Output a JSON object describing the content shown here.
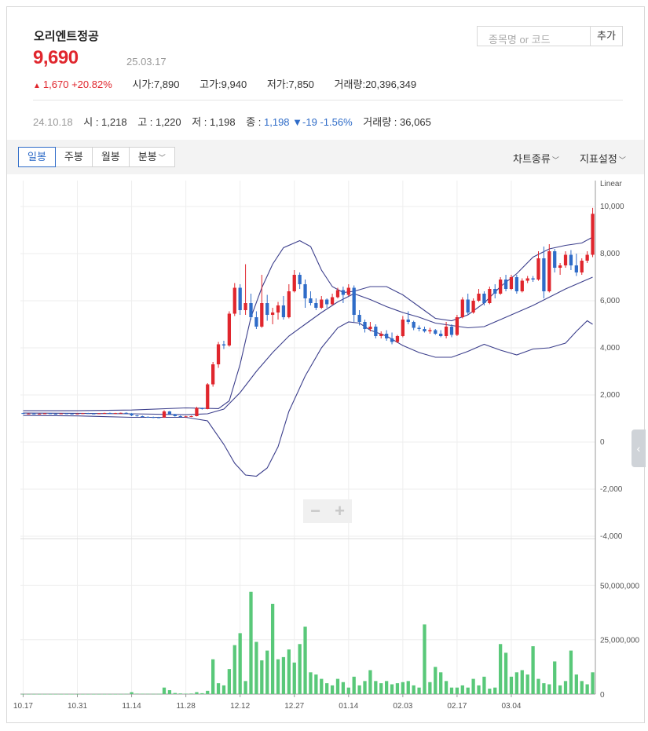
{
  "header": {
    "name": "오리엔트정공",
    "price": "9,690",
    "date": "25.03.17",
    "change_arrow": "▲",
    "change": "1,670",
    "change_pct": "+20.82%",
    "open_label": "시가",
    "open": "7,890",
    "high_label": "고가",
    "high": "9,940",
    "low_label": "저가",
    "low": "7,850",
    "volume_label": "거래량",
    "volume": "20,396,349"
  },
  "search": {
    "placeholder": "종목명 or 코드",
    "add_label": "추가"
  },
  "prev": {
    "date": "24.10.18",
    "open_label": "시",
    "open": "1,218",
    "high_label": "고",
    "high": "1,220",
    "low_label": "저",
    "low": "1,198",
    "close_label": "종",
    "close": "1,198",
    "change_arrow": "▼",
    "change": "-19",
    "change_pct": "-1.56%",
    "volume_label": "거래량",
    "volume": "36,065"
  },
  "toolbar": {
    "tabs": [
      "일봉",
      "주봉",
      "월봉",
      "분봉"
    ],
    "active_tab": 0,
    "chart_type_label": "차트종류",
    "indicator_label": "지표설정"
  },
  "zoom": {
    "minus": "−",
    "plus": "+"
  },
  "colors": {
    "up": "#e0262d",
    "down": "#2f6cc8",
    "bollinger": "#3c3f8c",
    "volume": "#59c879",
    "accent": "#2f6cc8"
  },
  "chart_data": [
    {
      "type": "candlestick",
      "scale_label": "Linear",
      "ylim": [
        -4000,
        11000
      ],
      "y_ticks": [
        10000,
        8000,
        6000,
        4000,
        2000,
        0,
        -2000,
        -4000
      ],
      "y_tick_labels": [
        "10,000",
        "8,000",
        "6,000",
        "4,000",
        "2,000",
        "0",
        "-2,000",
        "-4,000"
      ],
      "x_tick_labels": [
        "10.17",
        "10.31",
        "11.14",
        "11.28",
        "12.12",
        "12.27",
        "01.14",
        "02.03",
        "02.17",
        "03.04"
      ],
      "x_tick_index": [
        0,
        10,
        20,
        30,
        40,
        50,
        60,
        70,
        80,
        90
      ],
      "indicators": [
        "Bollinger Bands"
      ],
      "candles": [
        [
          1230,
          1240,
          1190,
          1200
        ],
        [
          1200,
          1220,
          1180,
          1210
        ],
        [
          1210,
          1230,
          1190,
          1195
        ],
        [
          1195,
          1215,
          1175,
          1205
        ],
        [
          1205,
          1230,
          1190,
          1220
        ],
        [
          1220,
          1235,
          1195,
          1200
        ],
        [
          1200,
          1215,
          1180,
          1190
        ],
        [
          1190,
          1225,
          1185,
          1215
        ],
        [
          1215,
          1230,
          1195,
          1205
        ],
        [
          1205,
          1215,
          1180,
          1195
        ],
        [
          1195,
          1220,
          1185,
          1210
        ],
        [
          1210,
          1235,
          1195,
          1225
        ],
        [
          1225,
          1240,
          1200,
          1210
        ],
        [
          1210,
          1225,
          1190,
          1200
        ],
        [
          1200,
          1230,
          1195,
          1220
        ],
        [
          1220,
          1245,
          1205,
          1235
        ],
        [
          1235,
          1250,
          1210,
          1220
        ],
        [
          1220,
          1240,
          1200,
          1230
        ],
        [
          1230,
          1250,
          1215,
          1240
        ],
        [
          1240,
          1260,
          1200,
          1215
        ],
        [
          1215,
          1230,
          1100,
          1130
        ],
        [
          1130,
          1150,
          1080,
          1100
        ],
        [
          1100,
          1120,
          1050,
          1070
        ],
        [
          1070,
          1090,
          1030,
          1060
        ],
        [
          1060,
          1080,
          1020,
          1050
        ],
        [
          1050,
          1070,
          1010,
          1040
        ],
        [
          1040,
          1350,
          1030,
          1300
        ],
        [
          1300,
          1320,
          1150,
          1180
        ],
        [
          1180,
          1200,
          1080,
          1100
        ],
        [
          1100,
          1130,
          1060,
          1080
        ],
        [
          1080,
          1110,
          1050,
          1090
        ],
        [
          1090,
          1120,
          1060,
          1100
        ],
        [
          1100,
          1500,
          1090,
          1450
        ],
        [
          1450,
          1460,
          1380,
          1400
        ],
        [
          1400,
          2500,
          1390,
          2450
        ],
        [
          2450,
          3400,
          2350,
          3300
        ],
        [
          3300,
          4250,
          3150,
          4150
        ],
        [
          4150,
          4300,
          3950,
          4100
        ],
        [
          4100,
          5550,
          4050,
          5450
        ],
        [
          5450,
          6750,
          5350,
          6550
        ],
        [
          6550,
          6700,
          5400,
          5600
        ],
        [
          5600,
          7550,
          5400,
          5900
        ],
        [
          5900,
          6300,
          5200,
          5300
        ],
        [
          5300,
          5550,
          4800,
          4900
        ],
        [
          4900,
          7100,
          4850,
          5900
        ],
        [
          5900,
          6250,
          5150,
          5400
        ],
        [
          5400,
          5700,
          5000,
          5500
        ],
        [
          5500,
          5950,
          5200,
          5800
        ],
        [
          5800,
          6200,
          5200,
          5300
        ],
        [
          5300,
          6700,
          5250,
          6400
        ],
        [
          6400,
          7300,
          6350,
          7100
        ],
        [
          7100,
          7200,
          6500,
          6700
        ],
        [
          6700,
          6900,
          5700,
          6100
        ],
        [
          6100,
          6400,
          5800,
          5900
        ],
        [
          5900,
          6100,
          5600,
          5700
        ],
        [
          5700,
          6200,
          5650,
          6050
        ],
        [
          6050,
          6100,
          5700,
          5850
        ],
        [
          5850,
          6300,
          5800,
          6150
        ],
        [
          6150,
          6550,
          6100,
          6450
        ],
        [
          6450,
          6600,
          5900,
          6250
        ],
        [
          6250,
          6700,
          6200,
          6550
        ],
        [
          6550,
          6650,
          5100,
          5400
        ],
        [
          5400,
          5600,
          4950,
          5100
        ],
        [
          5100,
          5200,
          4650,
          4800
        ],
        [
          4800,
          5100,
          4700,
          4900
        ],
        [
          4900,
          5000,
          4400,
          4500
        ],
        [
          4500,
          4700,
          4400,
          4600
        ],
        [
          4600,
          4750,
          4300,
          4400
        ],
        [
          4400,
          4650,
          4150,
          4250
        ],
        [
          4250,
          4550,
          4200,
          4500
        ],
        [
          4500,
          5350,
          4450,
          5200
        ],
        [
          5200,
          5550,
          5000,
          5100
        ],
        [
          5100,
          5150,
          4750,
          4850
        ],
        [
          4850,
          4950,
          4700,
          4800
        ],
        [
          4800,
          4900,
          4650,
          4700
        ],
        [
          4700,
          4850,
          4600,
          4750
        ],
        [
          4750,
          4800,
          4550,
          4600
        ],
        [
          4600,
          4750,
          4450,
          4500
        ],
        [
          4500,
          5100,
          4400,
          4900
        ],
        [
          4900,
          5000,
          4450,
          4550
        ],
        [
          4550,
          5400,
          4500,
          5300
        ],
        [
          5300,
          6150,
          5250,
          6050
        ],
        [
          6050,
          6300,
          5400,
          5500
        ],
        [
          5500,
          6100,
          5450,
          6000
        ],
        [
          6000,
          6500,
          5950,
          6300
        ],
        [
          6300,
          6400,
          5800,
          5900
        ],
        [
          5900,
          6600,
          5850,
          6500
        ],
        [
          6500,
          6700,
          6100,
          6300
        ],
        [
          6300,
          7000,
          6250,
          6900
        ],
        [
          6900,
          7100,
          6400,
          6500
        ],
        [
          6500,
          7100,
          6450,
          7000
        ],
        [
          7000,
          7100,
          6300,
          6400
        ],
        [
          6400,
          6950,
          6350,
          6850
        ],
        [
          6850,
          7050,
          6750,
          6950
        ],
        [
          6950,
          7050,
          6800,
          6900
        ],
        [
          6900,
          8100,
          6850,
          7800
        ],
        [
          7800,
          8300,
          6100,
          6400
        ],
        [
          6400,
          8400,
          6350,
          8100
        ],
        [
          8100,
          8200,
          7200,
          7400
        ],
        [
          7400,
          7600,
          7100,
          7500
        ],
        [
          7500,
          8100,
          7400,
          7950
        ],
        [
          7950,
          8150,
          7300,
          7500
        ],
        [
          7500,
          8000,
          7050,
          7200
        ],
        [
          7200,
          7800,
          7100,
          7700
        ],
        [
          7700,
          8100,
          7600,
          7950
        ],
        [
          7950,
          9940,
          7850,
          9690
        ]
      ],
      "bollinger": {
        "upper": [
          [
            0,
            1330
          ],
          [
            10,
            1330
          ],
          [
            20,
            1360
          ],
          [
            30,
            1450
          ],
          [
            36,
            1420
          ],
          [
            38,
            1750
          ],
          [
            40,
            3300
          ],
          [
            42,
            5300
          ],
          [
            44,
            6550
          ],
          [
            46,
            7550
          ],
          [
            48,
            8250
          ],
          [
            51,
            8550
          ],
          [
            53,
            8300
          ],
          [
            55,
            7300
          ],
          [
            57,
            6600
          ],
          [
            59,
            6350
          ],
          [
            61,
            6400
          ],
          [
            64,
            6600
          ],
          [
            67,
            6600
          ],
          [
            70,
            6250
          ],
          [
            73,
            5750
          ],
          [
            76,
            5250
          ],
          [
            79,
            5150
          ],
          [
            82,
            5400
          ],
          [
            85,
            5900
          ],
          [
            88,
            6600
          ],
          [
            91,
            7150
          ],
          [
            94,
            7850
          ],
          [
            97,
            8200
          ],
          [
            100,
            8350
          ],
          [
            103,
            8450
          ],
          [
            105,
            8700
          ]
        ],
        "middle": [
          [
            0,
            1230
          ],
          [
            10,
            1220
          ],
          [
            20,
            1200
          ],
          [
            30,
            1160
          ],
          [
            34,
            1200
          ],
          [
            37,
            1400
          ],
          [
            40,
            2100
          ],
          [
            43,
            3000
          ],
          [
            46,
            3800
          ],
          [
            49,
            4500
          ],
          [
            52,
            5000
          ],
          [
            55,
            5500
          ],
          [
            58,
            5950
          ],
          [
            61,
            6300
          ],
          [
            64,
            6050
          ],
          [
            67,
            5750
          ],
          [
            70,
            5500
          ],
          [
            73,
            5300
          ],
          [
            76,
            5050
          ],
          [
            79,
            4950
          ],
          [
            82,
            4850
          ],
          [
            85,
            4900
          ],
          [
            88,
            5200
          ],
          [
            91,
            5500
          ],
          [
            94,
            5800
          ],
          [
            97,
            6150
          ],
          [
            100,
            6500
          ],
          [
            103,
            6800
          ],
          [
            105,
            7000
          ]
        ],
        "lower": [
          [
            0,
            1130
          ],
          [
            10,
            1110
          ],
          [
            20,
            1050
          ],
          [
            30,
            1050
          ],
          [
            34,
            900
          ],
          [
            37,
            -100
          ],
          [
            39,
            -900
          ],
          [
            41,
            -1400
          ],
          [
            43,
            -1450
          ],
          [
            45,
            -1100
          ],
          [
            47,
            -200
          ],
          [
            49,
            1300
          ],
          [
            52,
            2800
          ],
          [
            55,
            4000
          ],
          [
            58,
            4850
          ],
          [
            60,
            5100
          ],
          [
            62,
            5050
          ],
          [
            64,
            4750
          ],
          [
            67,
            4500
          ],
          [
            70,
            4100
          ],
          [
            73,
            3800
          ],
          [
            76,
            3600
          ],
          [
            79,
            3600
          ],
          [
            82,
            3850
          ],
          [
            85,
            4150
          ],
          [
            88,
            3900
          ],
          [
            91,
            3700
          ],
          [
            94,
            3950
          ],
          [
            97,
            4000
          ],
          [
            100,
            4200
          ],
          [
            102,
            4700
          ],
          [
            104,
            5150
          ],
          [
            105,
            5000
          ]
        ]
      }
    },
    {
      "type": "bar",
      "series_label": "volume",
      "ylim": [
        0,
        70000000
      ],
      "y_ticks": [
        0,
        25000000,
        50000000
      ],
      "y_tick_labels": [
        "0",
        "25,000,000",
        "50,000,000"
      ],
      "values": [
        40000,
        35000,
        38000,
        30000,
        42000,
        30000,
        33000,
        36000,
        29000,
        31000,
        34000,
        36000,
        30000,
        28000,
        32000,
        40000,
        35000,
        30000,
        45000,
        120000,
        900000,
        200000,
        150000,
        120000,
        100000,
        90000,
        3000000,
        1800000,
        500000,
        300000,
        200000,
        250000,
        900000,
        400000,
        1500000,
        16000000,
        5000000,
        4000000,
        11500000,
        22500000,
        28000000,
        6000000,
        47000000,
        24000000,
        15500000,
        20000000,
        41500000,
        16000000,
        17000000,
        20500000,
        14500000,
        23000000,
        31000000,
        10000000,
        9000000,
        7000000,
        5000000,
        4000000,
        7000000,
        5500000,
        3000000,
        8000000,
        4000000,
        6000000,
        11000000,
        6000000,
        5000000,
        6000000,
        4500000,
        5000000,
        5500000,
        6000000,
        4000000,
        3000000,
        32000000,
        5500000,
        12500000,
        10000000,
        6000000,
        3000000,
        3000000,
        4000000,
        3000000,
        7000000,
        4000000,
        8000000,
        2500000,
        3000000,
        23000000,
        19000000,
        8000000,
        10000000,
        11000000,
        9000000,
        22000000,
        7000000,
        5000000,
        4500000,
        15000000,
        4000000,
        6000000,
        20000000,
        9000000,
        6000000,
        4500000,
        10000000
      ]
    }
  ]
}
